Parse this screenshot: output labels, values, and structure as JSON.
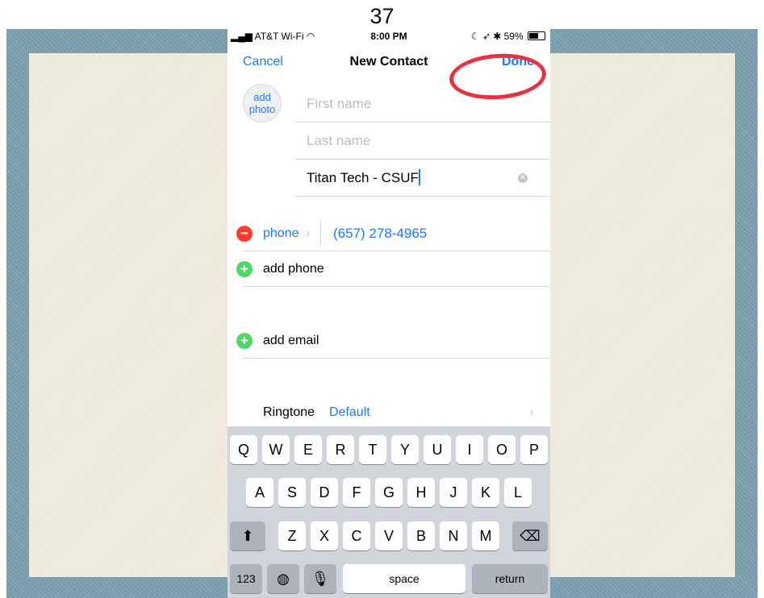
{
  "slide": {
    "number": "37"
  },
  "status_bar": {
    "carrier": "AT&T Wi-Fi",
    "time": "8:00 PM",
    "battery": "59%"
  },
  "nav": {
    "cancel": "Cancel",
    "title": "New Contact",
    "done": "Done"
  },
  "photo": {
    "line1": "add",
    "line2": "photo"
  },
  "fields": {
    "first_name_placeholder": "First name",
    "last_name_placeholder": "Last name",
    "company_value": "Titan Tech - CSUF"
  },
  "phone_row": {
    "type": "phone",
    "number": "(657) 278-4965"
  },
  "add_phone": "add phone",
  "add_email": "add email",
  "ringtone": {
    "label": "Ringtone",
    "value": "Default"
  },
  "keyboard": {
    "row1": [
      "Q",
      "W",
      "E",
      "R",
      "T",
      "Y",
      "U",
      "I",
      "O",
      "P"
    ],
    "row2": [
      "A",
      "S",
      "D",
      "F",
      "G",
      "H",
      "J",
      "K",
      "L"
    ],
    "row3": [
      "Z",
      "X",
      "C",
      "V",
      "B",
      "N",
      "M"
    ],
    "bottom": {
      "numbers": "123",
      "space": "space",
      "return": "return"
    }
  },
  "colors": {
    "accent": "#1a7cf5",
    "delete": "#ff3b30",
    "add": "#4cd964",
    "annotation": "#e8333f"
  }
}
